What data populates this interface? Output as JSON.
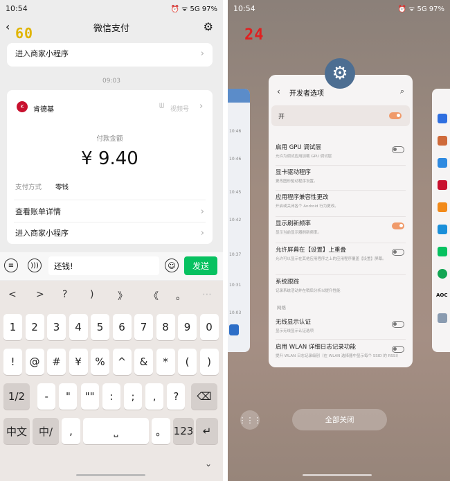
{
  "left": {
    "status": {
      "time": "10:54",
      "right": "⏰ ᯤ 5G 97%"
    },
    "fps": "60",
    "title": "微信支付",
    "mini_program_link": "进入商家小程序",
    "timestamp": "09:03",
    "merchant": "肯德基",
    "video_channel": "视频号",
    "amount_label": "付款金额",
    "amount": "¥ 9.40",
    "pay_method_label": "支付方式",
    "pay_method": "零钱",
    "bill_link": "查看账单详情",
    "mini_program_link2": "进入商家小程序",
    "input_value": "还钱!",
    "send_label": "发送",
    "suggestions": [
      "<",
      ">",
      "?",
      ")",
      "》",
      "《",
      "。",
      "⋯"
    ],
    "keys_row1": [
      "1",
      "2",
      "3",
      "4",
      "5",
      "6",
      "7",
      "8",
      "9",
      "0"
    ],
    "keys_row2": [
      "!",
      "@",
      "#",
      "¥",
      "%",
      "^",
      "&",
      "*",
      "(",
      ")"
    ],
    "keys_row3": [
      "1/2",
      "-",
      "\"",
      "\"\"",
      ":",
      ";",
      ",",
      "?"
    ],
    "key_zh": "中文",
    "key_zh_en": "中/",
    "key_comma": ",",
    "key_dot": "。",
    "key_123": "123"
  },
  "right": {
    "status": {
      "time": "10:54",
      "right": "⏰ ᯤ 5G 97%"
    },
    "fps": "24",
    "title": "开发者选项",
    "master_label": "开",
    "items": [
      {
        "title": "启用 GPU 调试层",
        "sub": "允许为调试应用加载 GPU 调试层",
        "toggle": "off"
      },
      {
        "title": "显卡驱动程序",
        "sub": "更改图形驱动程序设置。",
        "toggle": ""
      },
      {
        "title": "应用程序兼容性更改",
        "sub": "开启或关闭各个 Android 行为更改。",
        "toggle": ""
      },
      {
        "title": "显示刷新频率",
        "sub": "显示当前显示器刷新频率。",
        "toggle": "on"
      },
      {
        "title": "允许屏幕在【设置】上重叠",
        "sub": "允许可以显示在其他应用程序之上的应用程序覆盖【设置】屏幕。",
        "toggle": "off"
      },
      {
        "title": "系统跟踪",
        "sub": "记录系统活动并在稍后分析以提升性能",
        "toggle": ""
      }
    ],
    "section_network": "网络",
    "network_items": [
      {
        "title": "无线显示认证",
        "sub": "显示无线显示认证选项",
        "toggle": "off"
      },
      {
        "title": "启用 WLAN 详细日志记录功能",
        "sub": "提升 WLAN 日志记录级别（在 WLAN 选择器中显示每个 SSID 的 RSSI）",
        "toggle": "off"
      }
    ],
    "close_all": "全部关闭",
    "left_times": [
      "10:46",
      "10:46",
      "10:45",
      "10:42",
      "10:37",
      "10:31",
      "10:03"
    ]
  }
}
